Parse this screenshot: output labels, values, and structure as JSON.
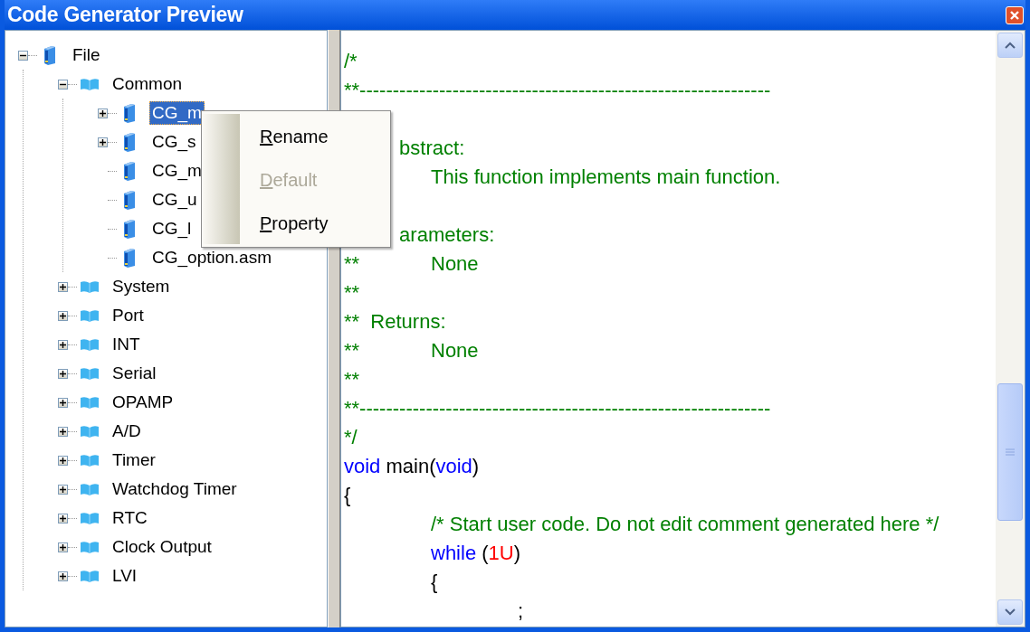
{
  "window": {
    "title": "Code Generator Preview"
  },
  "tree": [
    {
      "label": "File",
      "kind": "file",
      "expandable": true,
      "expanded": true,
      "selected": false,
      "children": [
        {
          "label": "Common",
          "kind": "folder",
          "expandable": true,
          "expanded": true,
          "selected": false,
          "children": [
            {
              "label": "CG_m",
              "kind": "file",
              "expandable": true,
              "expanded": false,
              "selected": true
            },
            {
              "label": "CG_s",
              "kind": "file",
              "expandable": true,
              "expanded": false,
              "selected": false
            },
            {
              "label": "CG_m",
              "kind": "file",
              "expandable": false,
              "selected": false
            },
            {
              "label": "CG_u",
              "kind": "file",
              "expandable": false,
              "selected": false
            },
            {
              "label": "CG_l",
              "kind": "file",
              "expandable": false,
              "selected": false
            },
            {
              "label": "CG_option.asm",
              "kind": "file",
              "expandable": false,
              "selected": false
            }
          ]
        },
        {
          "label": "System",
          "kind": "folder",
          "expandable": true,
          "expanded": false,
          "selected": false
        },
        {
          "label": "Port",
          "kind": "folder",
          "expandable": true,
          "expanded": false,
          "selected": false
        },
        {
          "label": "INT",
          "kind": "folder",
          "expandable": true,
          "expanded": false,
          "selected": false
        },
        {
          "label": "Serial",
          "kind": "folder",
          "expandable": true,
          "expanded": false,
          "selected": false
        },
        {
          "label": "OPAMP",
          "kind": "folder",
          "expandable": true,
          "expanded": false,
          "selected": false
        },
        {
          "label": "A/D",
          "kind": "folder",
          "expandable": true,
          "expanded": false,
          "selected": false
        },
        {
          "label": "Timer",
          "kind": "folder",
          "expandable": true,
          "expanded": false,
          "selected": false
        },
        {
          "label": "Watchdog Timer",
          "kind": "folder",
          "expandable": true,
          "expanded": false,
          "selected": false
        },
        {
          "label": "RTC",
          "kind": "folder",
          "expandable": true,
          "expanded": false,
          "selected": false
        },
        {
          "label": "Clock Output",
          "kind": "folder",
          "expandable": true,
          "expanded": false,
          "selected": false
        },
        {
          "label": "LVI",
          "kind": "folder",
          "expandable": true,
          "expanded": false,
          "selected": false
        }
      ]
    }
  ],
  "context_menu": [
    {
      "label": "Rename",
      "disabled": false
    },
    {
      "label": "Default",
      "disabled": true
    },
    {
      "label": "Property",
      "disabled": false
    }
  ],
  "code_lines": [
    {
      "segments": [
        {
          "kind": "comment",
          "text": "/*"
        }
      ]
    },
    {
      "segments": [
        {
          "kind": "comment",
          "text": "**--------------------------------------------------------------"
        }
      ]
    },
    {
      "kind": "below_covered_line",
      "segments": [
        {
          "kind": "comment",
          "text": "          bstract:"
        }
      ]
    },
    {
      "segments": [
        {
          "kind": "comment",
          "text": "\t\tThis function implements main function."
        }
      ]
    },
    {
      "kind": "below_covered_line",
      "segments": [
        {
          "kind": "comment",
          "text": "          arameters:"
        }
      ]
    },
    {
      "segments": [
        {
          "kind": "comment",
          "text": "**\t\tNone"
        }
      ]
    },
    {
      "segments": [
        {
          "kind": "comment",
          "text": "**"
        }
      ]
    },
    {
      "segments": [
        {
          "kind": "comment",
          "text": "**  Returns:"
        }
      ]
    },
    {
      "segments": [
        {
          "kind": "comment",
          "text": "**\t\tNone"
        }
      ]
    },
    {
      "segments": [
        {
          "kind": "comment",
          "text": "**"
        }
      ]
    },
    {
      "segments": [
        {
          "kind": "comment",
          "text": "**--------------------------------------------------------------"
        }
      ]
    },
    {
      "segments": [
        {
          "kind": "comment",
          "text": "*/"
        }
      ]
    },
    {
      "segments": [
        {
          "kind": "keyword",
          "text": "void"
        },
        {
          "kind": "plain",
          "text": " main("
        },
        {
          "kind": "keyword",
          "text": "void"
        },
        {
          "kind": "plain",
          "text": ")"
        }
      ]
    },
    {
      "segments": [
        {
          "kind": "plain",
          "text": "{"
        }
      ]
    },
    {
      "segments": [
        {
          "kind": "comment",
          "text": "\t\t/* Start user code. Do not edit comment generated here */"
        }
      ]
    },
    {
      "segments": [
        {
          "kind": "keyword",
          "text": "\t\twhile"
        },
        {
          "kind": "plain",
          "text": " ("
        },
        {
          "kind": "number",
          "text": "1U"
        },
        {
          "kind": "plain",
          "text": ")"
        }
      ]
    },
    {
      "segments": [
        {
          "kind": "plain",
          "text": "\t\t{"
        }
      ]
    },
    {
      "segments": [
        {
          "kind": "plain",
          "text": "\t\t\t\t;"
        }
      ]
    }
  ]
}
